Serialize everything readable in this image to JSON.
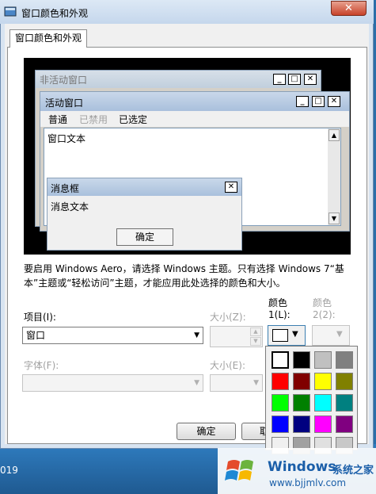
{
  "window": {
    "title": "窗口颜色和外观",
    "close_glyph": "✕"
  },
  "tab": {
    "label": "窗口颜色和外观"
  },
  "preview": {
    "inactive_title": "非活动窗口",
    "active_title": "活动窗口",
    "menu": {
      "normal": "普通",
      "disabled": "已禁用",
      "selected": "已选定"
    },
    "window_text": "窗口文本",
    "msgbox_title": "消息框",
    "msgbox_text": "消息文本",
    "msgbox_ok": "确定",
    "caption_glyphs": {
      "min": "_",
      "max": "□",
      "close": "✕"
    },
    "scroll": {
      "up": "▲",
      "down": "▼"
    }
  },
  "description": "要启用 Windows Aero，请选择 Windows 主题。只有选择 Windows 7“基本”主题或“轻松访问”主题，才能应用此处选择的颜色和大小。",
  "form": {
    "item_label": "项目(I):",
    "item_value": "窗口",
    "size_label": "大小(Z):",
    "color1_label_line1": "颜色",
    "color1_label_line2": "1(L):",
    "color2_label_line1": "颜色",
    "color2_label_line2": "2(2):",
    "font_label": "字体(F):",
    "font_size_label": "大小(E):",
    "dropdown_glyph": "▼",
    "spin_up": "▲",
    "spin_down": "▼"
  },
  "palette": {
    "colors": [
      "#ffffff",
      "#000000",
      "#c0c0c0",
      "#808080",
      "#ff0000",
      "#800000",
      "#ffff00",
      "#808000",
      "#00ff00",
      "#008000",
      "#00ffff",
      "#008080",
      "#0000ff",
      "#000080",
      "#ff00ff",
      "#800080",
      "#f0f0f0",
      "#a0a0a0",
      "#e0e0e0",
      "#c8c8c8"
    ],
    "selected_index": 0
  },
  "buttons": {
    "ok": "确定",
    "cancel": "取"
  },
  "desktop": {
    "clock_fragment": "019"
  },
  "watermark": {
    "title": "Windows",
    "subtitle": "系统之家",
    "url": "www.bjjmlv.com"
  }
}
